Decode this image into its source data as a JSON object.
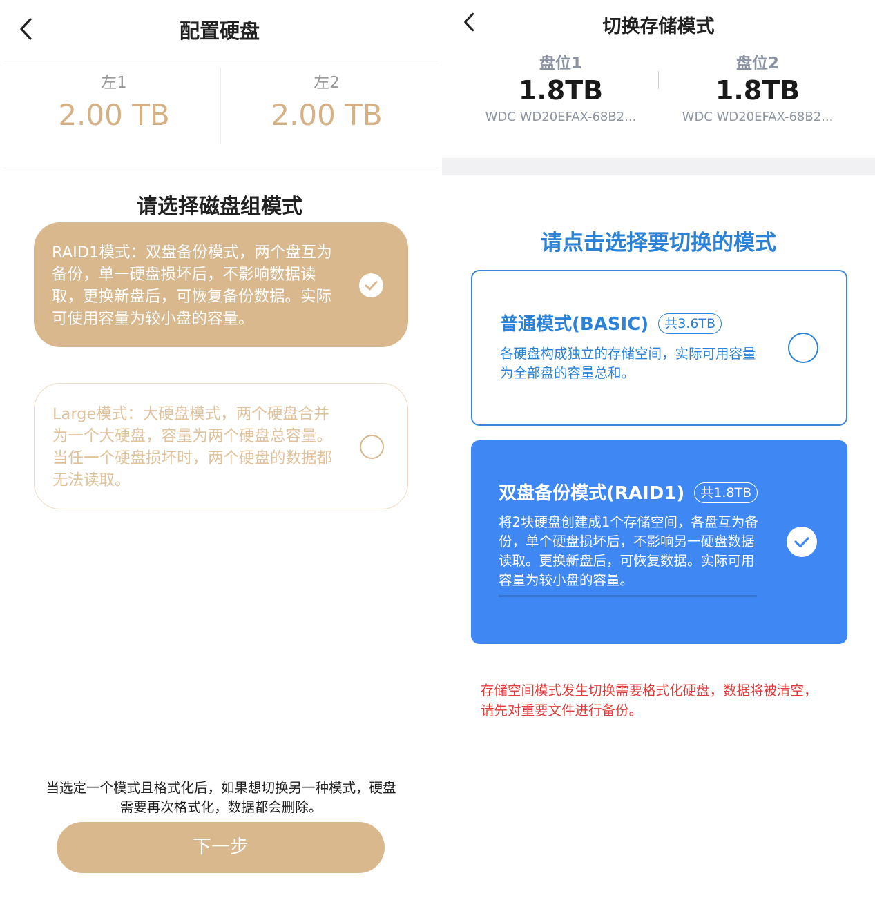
{
  "left": {
    "title": "配置硬盘",
    "disks": [
      {
        "name": "左1",
        "size": "2.00 TB"
      },
      {
        "name": "左2",
        "size": "2.00 TB"
      }
    ],
    "section_title": "请选择磁盘组模式",
    "modes": [
      {
        "text": "RAID1模式：双盘备份模式，两个盘互为备份，单一硬盘损坏后，不影响数据读取，更换新盘后，可恢复备份数据。实际可使用容量为较小盘的容量。",
        "selected": true
      },
      {
        "text": "Large模式：大硬盘模式，两个硬盘合并为一个大硬盘，容量为两个硬盘总容量。当任一个硬盘损坏时，两个硬盘的数据都无法读取。",
        "selected": false
      }
    ],
    "note": "当选定一个模式且格式化后，如果想切换另一种模式，硬盘需要再次格式化，数据都会删除。",
    "next_button": "下一步",
    "colors": {
      "accent": "#d9b88d",
      "accent_text": "#d6b185"
    }
  },
  "right": {
    "title": "切换存储模式",
    "slots": [
      {
        "name": "盘位1",
        "size": "1.8TB",
        "model": "WDC WD20EFAX-68B2..."
      },
      {
        "name": "盘位2",
        "size": "1.8TB",
        "model": "WDC WD20EFAX-68B2..."
      }
    ],
    "section_title": "请点击选择要切换的模式",
    "modes": [
      {
        "title": "普通模式(BASIC)",
        "capacity": "共3.6TB",
        "desc": "各硬盘构成独立的存储空间，实际可用容量为全部盘的容量总和。",
        "selected": false
      },
      {
        "title": "双盘备份模式(RAID1)",
        "capacity": "共1.8TB",
        "desc": "将2块硬盘创建成1个存储空间，各盘互为备份，单个硬盘损坏后，不影响另一硬盘数据读取。更换新盘后，可恢复数据。实际可用容量为较小盘的容量。",
        "selected": true
      }
    ],
    "warning": "存储空间模式发生切换需要格式化硬盘，数据将被清空，请先对重要文件进行备份。",
    "colors": {
      "accent": "#3f87f3",
      "title_blue": "#2b82d7",
      "warning": "#e23b3b"
    }
  },
  "icons": {
    "back": "chevron-left-icon",
    "check": "check-icon",
    "radio_empty": "radio-empty-icon"
  }
}
